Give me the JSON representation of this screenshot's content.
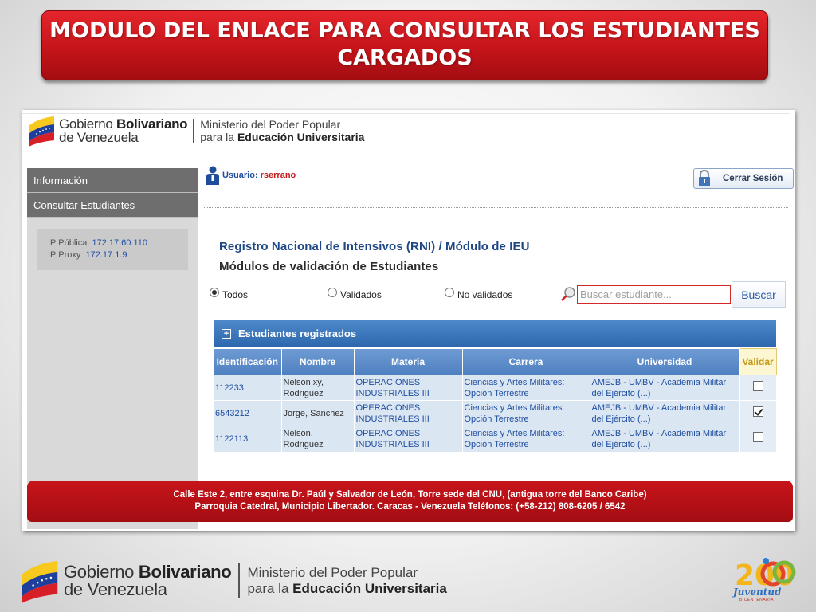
{
  "slide": {
    "title_line1": "MODULO DEL ENLACE PARA CONSULTAR LOS ESTUDIANTES",
    "title_line2": "CARGADOS"
  },
  "logo": {
    "gov_prefix": "Gobierno",
    "gov_bold": "Bolivariano",
    "gov_line2": "de Venezuela",
    "ministry_line1": "Ministerio del Poder Popular",
    "ministry_prefix": "para la",
    "ministry_bold": "Educación Universitaria"
  },
  "sidebar": {
    "items": [
      {
        "label": "Información"
      },
      {
        "label": "Consultar Estudiantes"
      }
    ],
    "ip_public_label": "IP Pública:",
    "ip_public_value": "172.17.60.110",
    "ip_proxy_label": "IP Proxy:",
    "ip_proxy_value": "172.17.1.9"
  },
  "user": {
    "label": "Usuario:",
    "name": "rserrano",
    "logout_label": "Cerrar Sesión"
  },
  "main": {
    "heading1": "Registro Nacional de Intensivos (RNI) / Módulo de IEU",
    "heading2": "Módulos de validación de Estudiantes"
  },
  "filters": {
    "options": [
      {
        "label": "Todos",
        "selected": true
      },
      {
        "label": "Validados",
        "selected": false
      },
      {
        "label": "No validados",
        "selected": false
      }
    ],
    "search_placeholder": "Buscar estudiante...",
    "search_button": "Buscar"
  },
  "table": {
    "panel_title": "Estudiantes registrados",
    "columns": [
      "Identificación",
      "Nombre",
      "Materia",
      "Carrera",
      "Universidad",
      "Validar"
    ],
    "rows": [
      {
        "id": "112233",
        "name": "Nelson xy, Rodriguez",
        "materia": "OPERACIONES INDUSTRIALES III",
        "carrera": "Ciencias y Artes Militares: Opción Terrestre",
        "universidad": "AMEJB - UMBV - Academia Militar del Ejército (...)",
        "validado": false
      },
      {
        "id": "6543212",
        "name": "Jorge, Sanchez",
        "materia": "OPERACIONES INDUSTRIALES III",
        "carrera": "Ciencias y Artes Militares: Opción Terrestre",
        "universidad": "AMEJB - UMBV - Academia Militar del Ejército (...)",
        "validado": true
      },
      {
        "id": "1122113",
        "name": "Nelson, Rodriguez",
        "materia": "OPERACIONES INDUSTRIALES III",
        "carrera": "Ciencias y Artes Militares: Opción Terrestre",
        "universidad": "AMEJB - UMBV - Academia Militar del Ejército (...)",
        "validado": false
      }
    ]
  },
  "footer": {
    "line1": "Calle Este 2, entre esquina Dr. Paúl y Salvador de León, Torre sede del CNU, (antigua torre del Banco Caribe)",
    "line2": "Parroquia Catedral, Municipio Libertador. Caracas - Venezuela Teléfonos: (+58-212) 808-6205 / 6542"
  },
  "bicentennial": {
    "number": "200",
    "text": "Juventud",
    "subtext": "BICENTENARIA"
  },
  "colors": {
    "brand_red": "#c5141a",
    "table_blue": "#2e67ad",
    "link_blue": "#1e4ea0"
  }
}
